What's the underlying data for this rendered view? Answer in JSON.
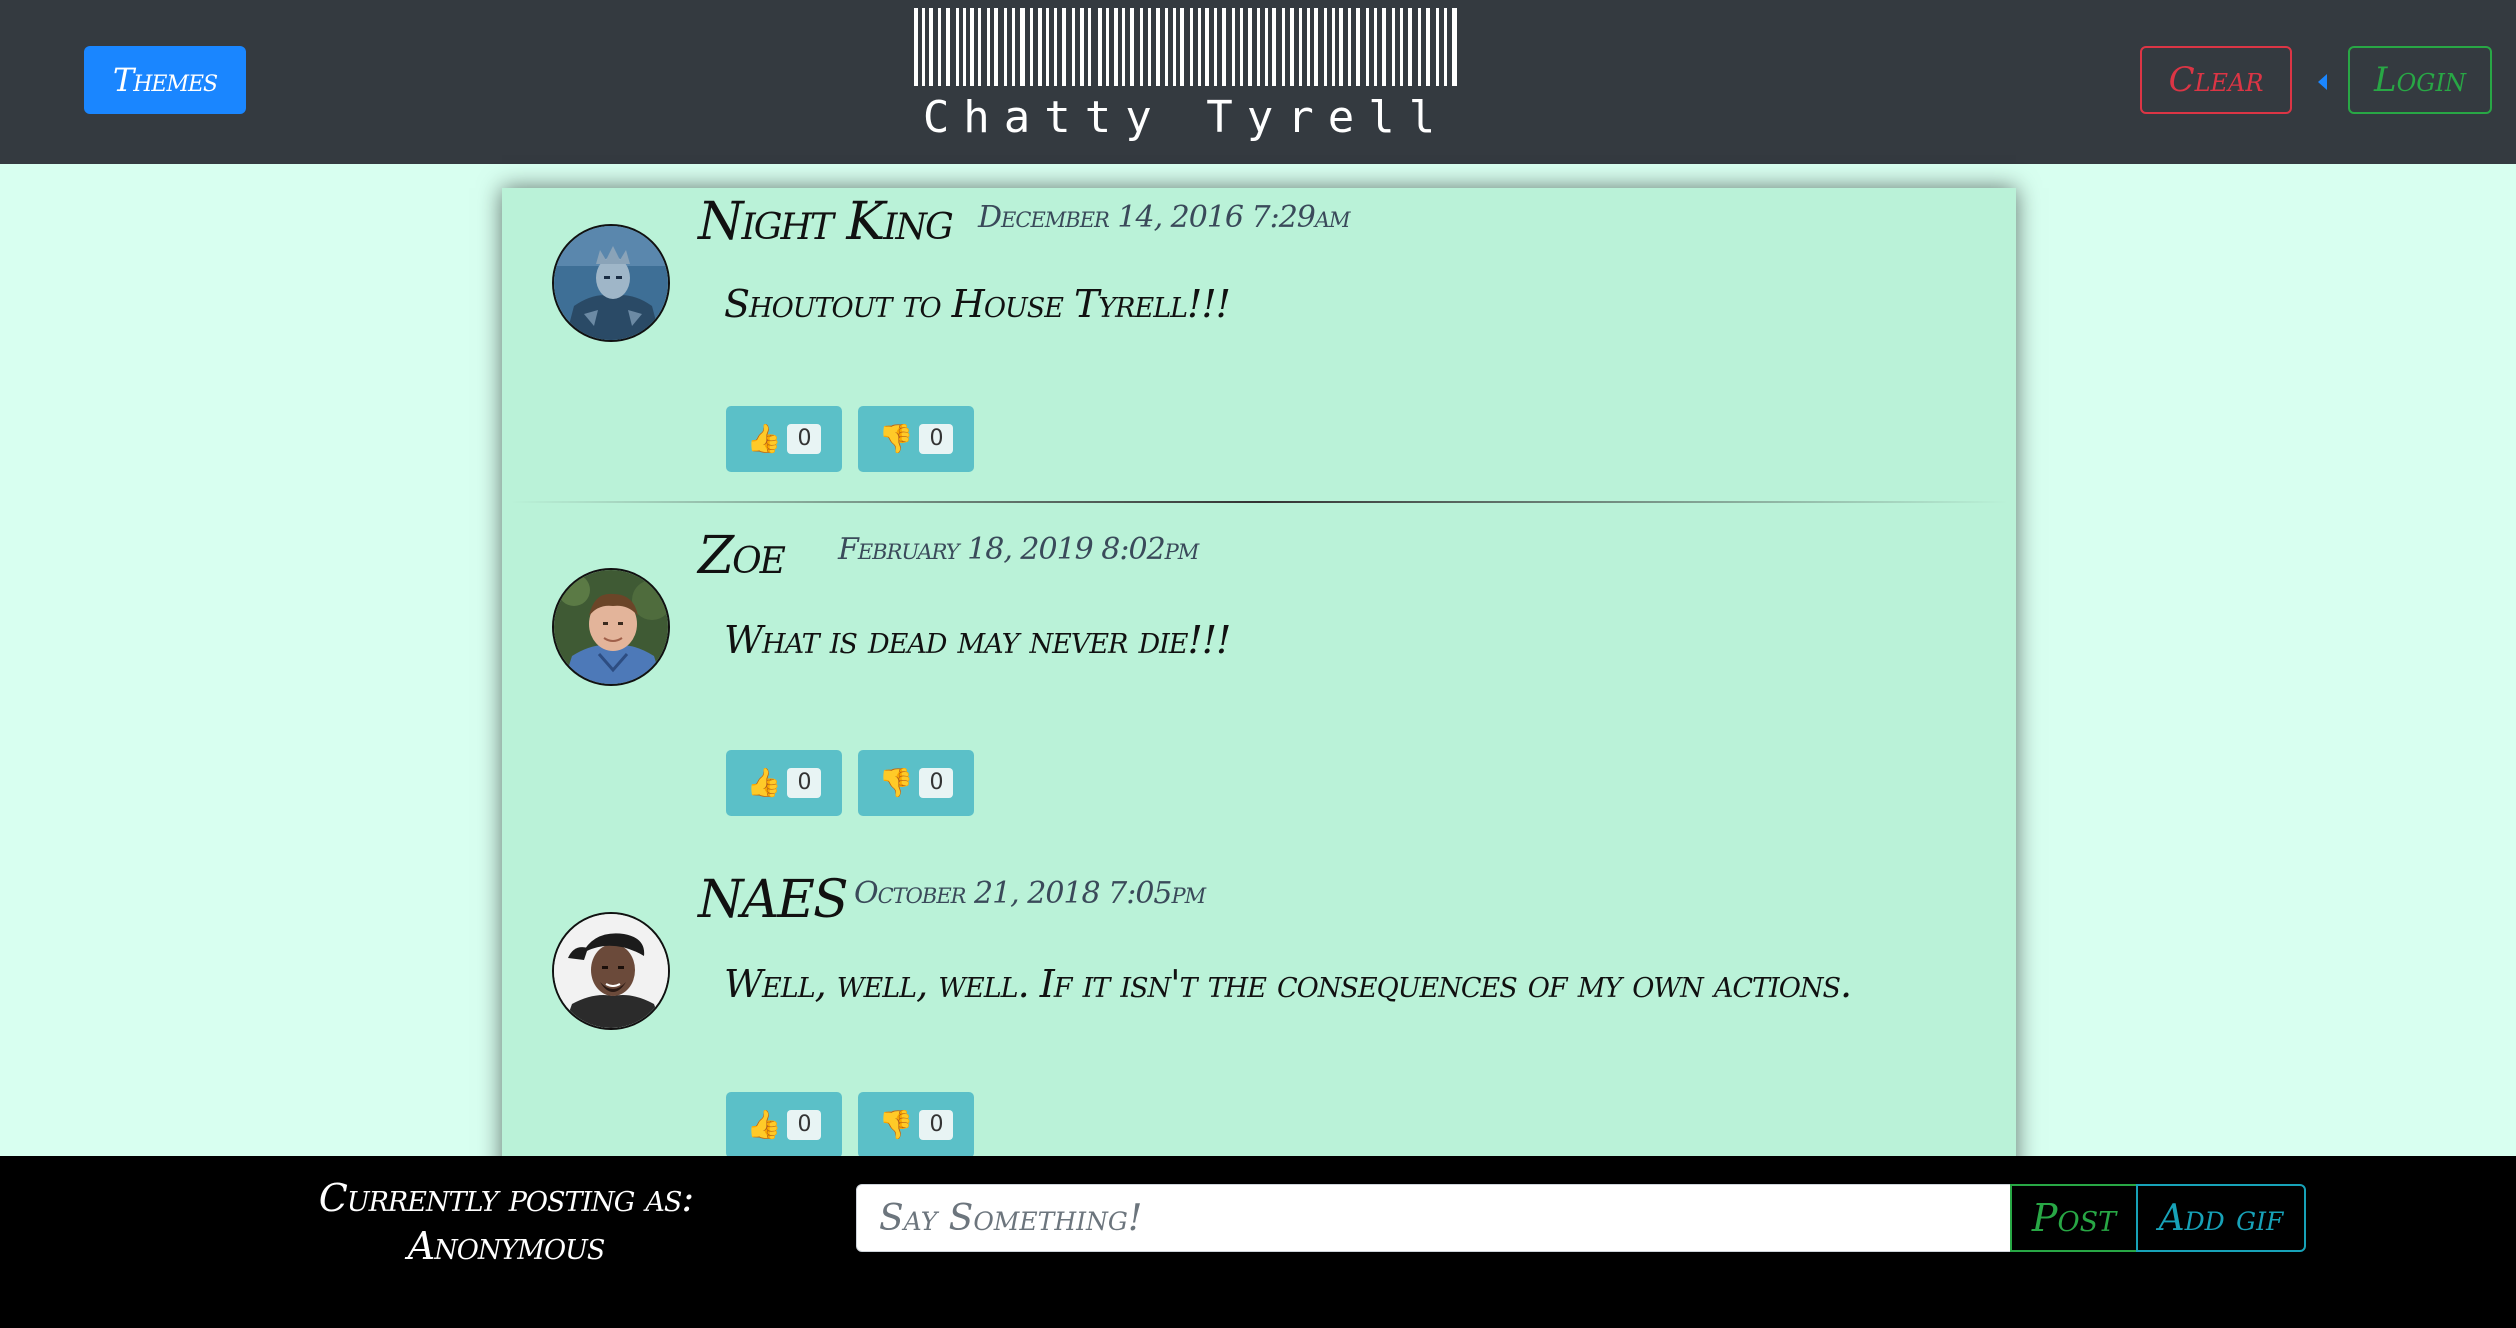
{
  "navbar": {
    "themes_label": "Themes",
    "logo_text": "Chatty Tyrell",
    "clear_label": "Clear",
    "login_label": "Login"
  },
  "posts": [
    {
      "author": "Night King",
      "timestamp": "December 14, 2016 7:29am",
      "message": "Shoutout to House Tyrell!!!",
      "likes": "0",
      "dislikes": "0",
      "avatar_icon": "night-king-avatar"
    },
    {
      "author": "Zoe",
      "timestamp": "February 18, 2019 8:02pm",
      "message": "What is dead may never die!!!",
      "likes": "0",
      "dislikes": "0",
      "avatar_icon": "zoe-avatar"
    },
    {
      "author": "NAES",
      "timestamp": "October 21, 2018 7:05pm",
      "message": "Well, well, well. If it isn't the consequences of my own actions.",
      "likes": "0",
      "dislikes": "0",
      "avatar_icon": "naes-avatar"
    }
  ],
  "icons": {
    "like": "👍",
    "dislike": "👎"
  },
  "footer": {
    "posting_as_label": "Currently posting as:",
    "posting_as_user": "Anonymous",
    "input_placeholder": "Say Something!",
    "input_value": "",
    "post_label": "Post",
    "gif_label": "Add gif"
  },
  "colors": {
    "navbar": "#343a40",
    "page_bg": "#d8fff0",
    "feed_bg": "#baf2d8",
    "vote_button": "#5bc0c8",
    "primary": "#1a86ff",
    "danger": "#dc3545",
    "success": "#28a745",
    "info": "#17a2b8"
  }
}
